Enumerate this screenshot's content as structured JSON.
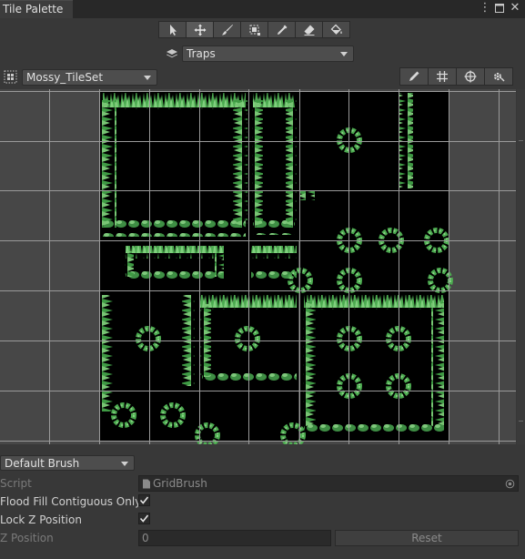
{
  "window": {
    "tab_title": "Tile Palette"
  },
  "toolbar": {
    "tools": [
      "select-icon",
      "move-icon",
      "paint-brush-icon",
      "box-fill-icon",
      "picker-icon",
      "eraser-icon",
      "fill-bucket-icon"
    ],
    "active_tool_index": 1
  },
  "active_target": {
    "label": "Traps"
  },
  "palette": {
    "name": "Mossy_TileSet"
  },
  "edit_tools": [
    "edit-pencil-icon",
    "grid-toggle-icon",
    "gizmo-icon",
    "settings-gear-icon"
  ],
  "brush": {
    "selected": "Default Brush",
    "script_label": "Script",
    "script_value": "GridBrush",
    "flood_fill_label": "Flood Fill Contiguous Only",
    "flood_fill_checked": true,
    "lock_z_label": "Lock Z Position",
    "lock_z_checked": true,
    "z_position_label": "Z Position",
    "z_position_value": "0",
    "reset_label": "Reset"
  },
  "colors": {
    "background": "#383838",
    "grid_bg": "#474747",
    "grid_line": "#9a9a9a",
    "tile_dark": "#000000",
    "moss_green": "#4caa50"
  }
}
